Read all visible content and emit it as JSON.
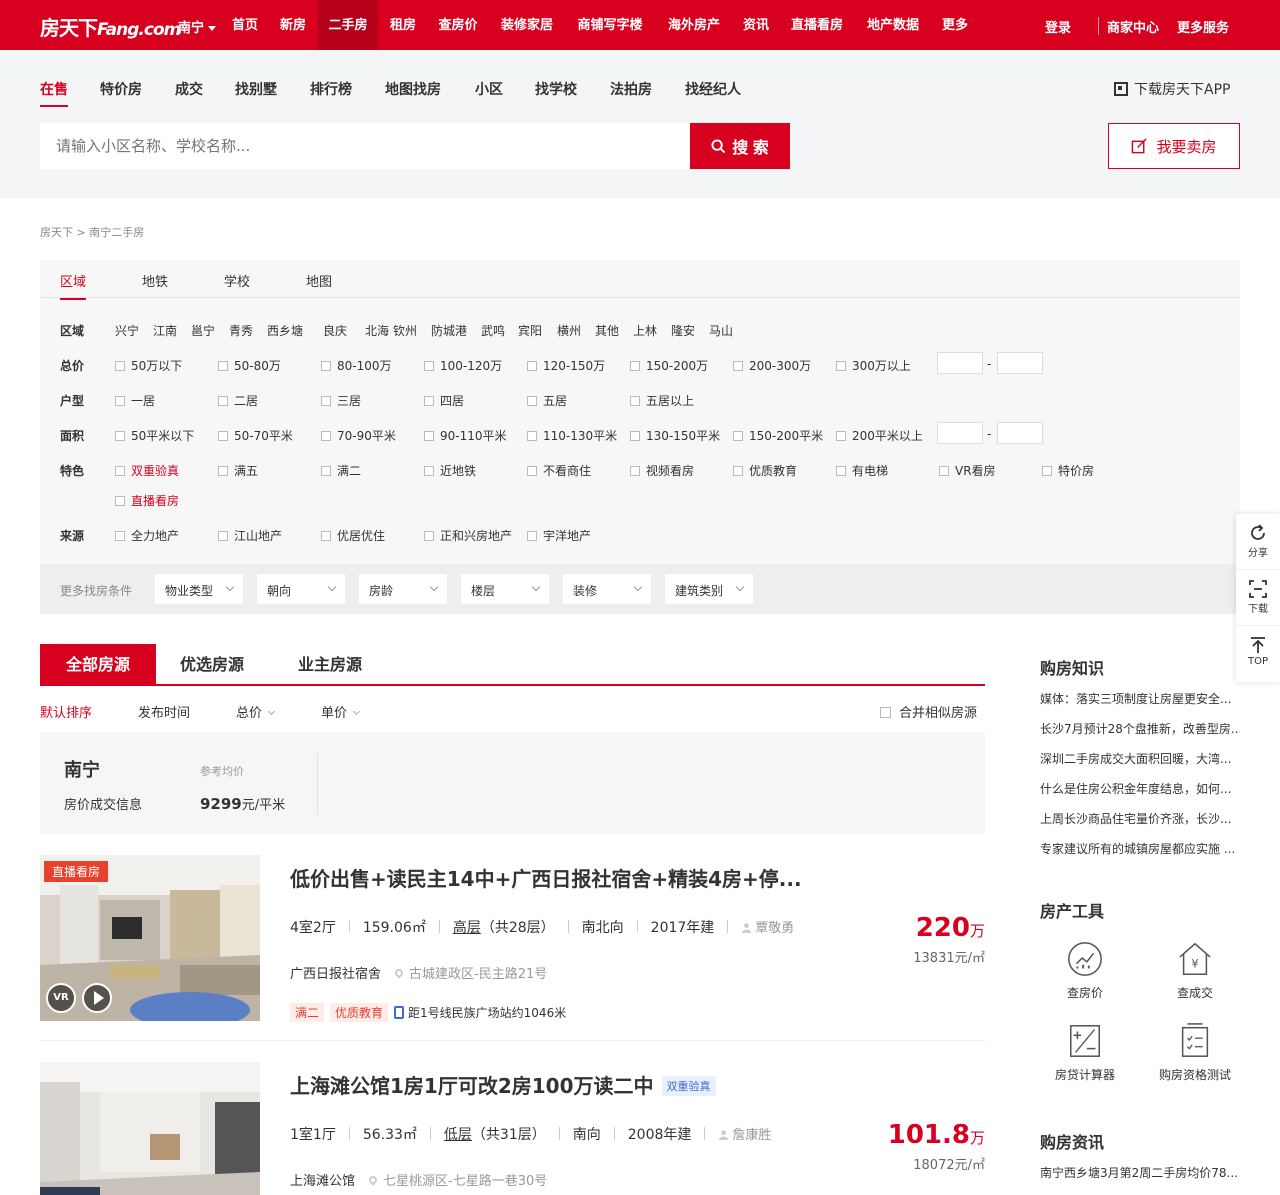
{
  "header": {
    "logo": "房天下",
    "logo_en": "Fang.com",
    "city": "南宁",
    "nav": [
      {
        "label": "首页"
      },
      {
        "label": "新房"
      },
      {
        "label": "二手房"
      },
      {
        "label": "租房"
      },
      {
        "label": "查房价"
      },
      {
        "label": "装修家居"
      },
      {
        "label": "商铺写字楼"
      },
      {
        "label": "海外房产"
      },
      {
        "label": "资讯"
      },
      {
        "label": "直播看房"
      },
      {
        "label": "地产数据"
      },
      {
        "label": "更多"
      }
    ],
    "login": "登录",
    "merchant": "商家中心",
    "more_services": "更多服务",
    "brand_color": "#d7001f"
  },
  "subnav": {
    "items": [
      {
        "label": "在售"
      },
      {
        "label": "特价房"
      },
      {
        "label": "成交"
      },
      {
        "label": "找别墅"
      },
      {
        "label": "排行榜"
      },
      {
        "label": "地图找房"
      },
      {
        "label": "小区"
      },
      {
        "label": "找学校"
      },
      {
        "label": "法拍房"
      },
      {
        "label": "找经纪人"
      }
    ],
    "app_download": "下载房天下APP"
  },
  "search": {
    "placeholder": "请输入小区名称、学校名称...",
    "button": "搜 索",
    "sell_button": "我要卖房"
  },
  "breadcrumb": "房天下 > 南宁二手房",
  "filter": {
    "tabs": [
      {
        "label": "区域"
      },
      {
        "label": "地铁"
      },
      {
        "label": "学校"
      },
      {
        "label": "地图"
      }
    ],
    "district_label": "区域",
    "districts": [
      "兴宁",
      "江南",
      "邕宁",
      "青秀",
      "西乡塘",
      "良庆",
      "北海",
      "钦州",
      "防城港",
      "武鸣",
      "宾阳",
      "横州",
      "其他",
      "上林",
      "隆安",
      "马山"
    ],
    "price_label": "总价",
    "prices": [
      "50万以下",
      "50-80万",
      "80-100万",
      "100-120万",
      "120-150万",
      "150-200万",
      "200-300万",
      "300万以上"
    ],
    "layout_label": "户型",
    "layouts": [
      "一居",
      "二居",
      "三居",
      "四居",
      "五居",
      "五居以上"
    ],
    "area_label": "面积",
    "areas": [
      "50平米以下",
      "50-70平米",
      "70-90平米",
      "90-110平米",
      "110-130平米",
      "130-150平米",
      "150-200平米",
      "200平米以上"
    ],
    "feature_label": "特色",
    "features": [
      "双重验真",
      "满五",
      "满二",
      "近地铁",
      "不看商住",
      "视频看房",
      "优质教育",
      "有电梯",
      "VR看房",
      "特价房",
      "直播看房"
    ],
    "source_label": "来源",
    "sources": [
      "全力地产",
      "江山地产",
      "优居优住",
      "正和兴房地产",
      "宇洋地产"
    ],
    "range_dash": "-",
    "more_label": "更多找房条件",
    "more_dropdowns": [
      "物业类型",
      "朝向",
      "房龄",
      "楼层",
      "装修",
      "建筑类别"
    ]
  },
  "list": {
    "tabs": [
      {
        "label": "全部房源"
      },
      {
        "label": "优选房源"
      },
      {
        "label": "业主房源"
      }
    ],
    "sorts": [
      {
        "label": "默认排序"
      },
      {
        "label": "发布时间"
      },
      {
        "label": "总价"
      },
      {
        "label": "单价"
      }
    ],
    "merge_label": "合并相似房源",
    "ref_city": "南宁",
    "ref_info": "房价成交信息",
    "ref_avg_label": "参考均价",
    "ref_avg_value": "9299",
    "ref_avg_unit": "元/平米",
    "listings": [
      {
        "live_tag": "直播看房",
        "vr": "VR",
        "title": "低价出售+读民主14中+广西日报社宿舍+精装4房+停...",
        "rooms": "4室2厅",
        "area": "159.06㎡",
        "floor": "高层",
        "floor_total": "（共28层）",
        "orientation": "南北向",
        "year": "2017年建",
        "agent": "覃敬勇",
        "community": "广西日报社宿舍",
        "address": "古城建政区-民主路21号",
        "tags": [
          "满二",
          "优质教育"
        ],
        "subway": "距1号线民族广场站约1046米",
        "price": "220",
        "price_unit": "万",
        "unit_price": "13831元/㎡"
      },
      {
        "title": "上海滩公馆1房1厅可改2房100万读二中",
        "title_tag": "双重验真",
        "rooms": "1室1厅",
        "area": "56.33㎡",
        "floor": "低层",
        "floor_total": "（共31层）",
        "orientation": "南向",
        "year": "2008年建",
        "agent": "詹康胜",
        "community": "上海滩公馆",
        "address": "七星桃源区-七星路一巷30号",
        "price": "101.8",
        "price_unit": "万",
        "unit_price": "18072元/㎡"
      }
    ]
  },
  "sidebar": {
    "knowledge_title": "购房知识",
    "knowledge": [
      "媒体：落实三项制度让房屋更安全...",
      "长沙7月预计28个盘推新，改善型房...",
      "深圳二手房成交大面积回暖，大湾...",
      "什么是住房公积金年度结息，如何...",
      "上周长沙商品住宅量价齐涨，长沙...",
      "专家建议所有的城镇房屋都应实施 ..."
    ],
    "tools_title": "房产工具",
    "tools": [
      {
        "label": "查房价",
        "icon": "chart-icon"
      },
      {
        "label": "查成交",
        "icon": "house-yuan-icon"
      },
      {
        "label": "房贷计算器",
        "icon": "calculator-icon"
      },
      {
        "label": "购房资格测试",
        "icon": "checklist-icon"
      }
    ],
    "news_title": "购房资讯",
    "news": [
      "南宁西乡塘3月第2周二手房均价78..."
    ]
  },
  "floating": {
    "share": "分享",
    "download": "下载",
    "top": "TOP"
  }
}
